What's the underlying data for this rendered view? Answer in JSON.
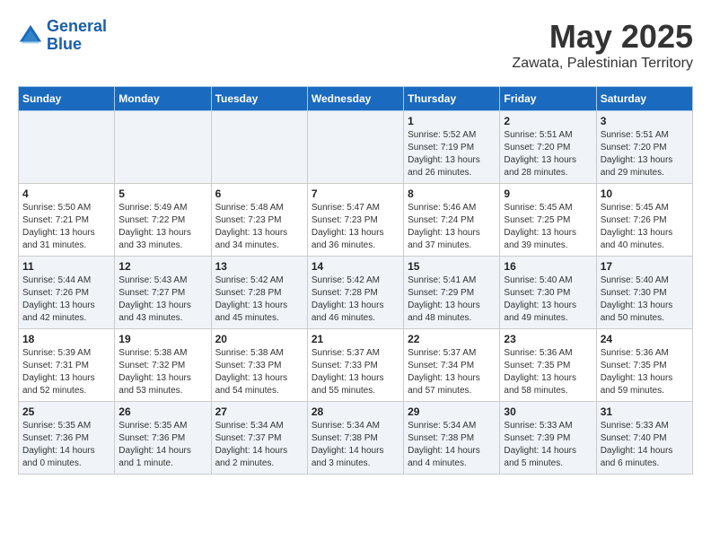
{
  "logo": {
    "line1": "General",
    "line2": "Blue"
  },
  "title": "May 2025",
  "subtitle": "Zawata, Palestinian Territory",
  "days_of_week": [
    "Sunday",
    "Monday",
    "Tuesday",
    "Wednesday",
    "Thursday",
    "Friday",
    "Saturday"
  ],
  "weeks": [
    [
      {
        "day": "",
        "detail": ""
      },
      {
        "day": "",
        "detail": ""
      },
      {
        "day": "",
        "detail": ""
      },
      {
        "day": "",
        "detail": ""
      },
      {
        "day": "1",
        "detail": "Sunrise: 5:52 AM\nSunset: 7:19 PM\nDaylight: 13 hours\nand 26 minutes."
      },
      {
        "day": "2",
        "detail": "Sunrise: 5:51 AM\nSunset: 7:20 PM\nDaylight: 13 hours\nand 28 minutes."
      },
      {
        "day": "3",
        "detail": "Sunrise: 5:51 AM\nSunset: 7:20 PM\nDaylight: 13 hours\nand 29 minutes."
      }
    ],
    [
      {
        "day": "4",
        "detail": "Sunrise: 5:50 AM\nSunset: 7:21 PM\nDaylight: 13 hours\nand 31 minutes."
      },
      {
        "day": "5",
        "detail": "Sunrise: 5:49 AM\nSunset: 7:22 PM\nDaylight: 13 hours\nand 33 minutes."
      },
      {
        "day": "6",
        "detail": "Sunrise: 5:48 AM\nSunset: 7:23 PM\nDaylight: 13 hours\nand 34 minutes."
      },
      {
        "day": "7",
        "detail": "Sunrise: 5:47 AM\nSunset: 7:23 PM\nDaylight: 13 hours\nand 36 minutes."
      },
      {
        "day": "8",
        "detail": "Sunrise: 5:46 AM\nSunset: 7:24 PM\nDaylight: 13 hours\nand 37 minutes."
      },
      {
        "day": "9",
        "detail": "Sunrise: 5:45 AM\nSunset: 7:25 PM\nDaylight: 13 hours\nand 39 minutes."
      },
      {
        "day": "10",
        "detail": "Sunrise: 5:45 AM\nSunset: 7:26 PM\nDaylight: 13 hours\nand 40 minutes."
      }
    ],
    [
      {
        "day": "11",
        "detail": "Sunrise: 5:44 AM\nSunset: 7:26 PM\nDaylight: 13 hours\nand 42 minutes."
      },
      {
        "day": "12",
        "detail": "Sunrise: 5:43 AM\nSunset: 7:27 PM\nDaylight: 13 hours\nand 43 minutes."
      },
      {
        "day": "13",
        "detail": "Sunrise: 5:42 AM\nSunset: 7:28 PM\nDaylight: 13 hours\nand 45 minutes."
      },
      {
        "day": "14",
        "detail": "Sunrise: 5:42 AM\nSunset: 7:28 PM\nDaylight: 13 hours\nand 46 minutes."
      },
      {
        "day": "15",
        "detail": "Sunrise: 5:41 AM\nSunset: 7:29 PM\nDaylight: 13 hours\nand 48 minutes."
      },
      {
        "day": "16",
        "detail": "Sunrise: 5:40 AM\nSunset: 7:30 PM\nDaylight: 13 hours\nand 49 minutes."
      },
      {
        "day": "17",
        "detail": "Sunrise: 5:40 AM\nSunset: 7:30 PM\nDaylight: 13 hours\nand 50 minutes."
      }
    ],
    [
      {
        "day": "18",
        "detail": "Sunrise: 5:39 AM\nSunset: 7:31 PM\nDaylight: 13 hours\nand 52 minutes."
      },
      {
        "day": "19",
        "detail": "Sunrise: 5:38 AM\nSunset: 7:32 PM\nDaylight: 13 hours\nand 53 minutes."
      },
      {
        "day": "20",
        "detail": "Sunrise: 5:38 AM\nSunset: 7:33 PM\nDaylight: 13 hours\nand 54 minutes."
      },
      {
        "day": "21",
        "detail": "Sunrise: 5:37 AM\nSunset: 7:33 PM\nDaylight: 13 hours\nand 55 minutes."
      },
      {
        "day": "22",
        "detail": "Sunrise: 5:37 AM\nSunset: 7:34 PM\nDaylight: 13 hours\nand 57 minutes."
      },
      {
        "day": "23",
        "detail": "Sunrise: 5:36 AM\nSunset: 7:35 PM\nDaylight: 13 hours\nand 58 minutes."
      },
      {
        "day": "24",
        "detail": "Sunrise: 5:36 AM\nSunset: 7:35 PM\nDaylight: 13 hours\nand 59 minutes."
      }
    ],
    [
      {
        "day": "25",
        "detail": "Sunrise: 5:35 AM\nSunset: 7:36 PM\nDaylight: 14 hours\nand 0 minutes."
      },
      {
        "day": "26",
        "detail": "Sunrise: 5:35 AM\nSunset: 7:36 PM\nDaylight: 14 hours\nand 1 minute."
      },
      {
        "day": "27",
        "detail": "Sunrise: 5:34 AM\nSunset: 7:37 PM\nDaylight: 14 hours\nand 2 minutes."
      },
      {
        "day": "28",
        "detail": "Sunrise: 5:34 AM\nSunset: 7:38 PM\nDaylight: 14 hours\nand 3 minutes."
      },
      {
        "day": "29",
        "detail": "Sunrise: 5:34 AM\nSunset: 7:38 PM\nDaylight: 14 hours\nand 4 minutes."
      },
      {
        "day": "30",
        "detail": "Sunrise: 5:33 AM\nSunset: 7:39 PM\nDaylight: 14 hours\nand 5 minutes."
      },
      {
        "day": "31",
        "detail": "Sunrise: 5:33 AM\nSunset: 7:40 PM\nDaylight: 14 hours\nand 6 minutes."
      }
    ]
  ]
}
